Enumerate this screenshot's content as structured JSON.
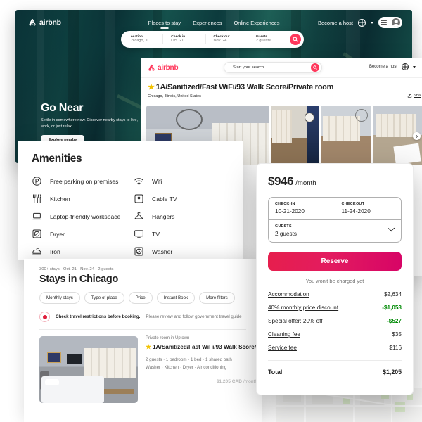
{
  "brand": {
    "name": "airbnb",
    "accent": "#FF385C",
    "reserve_gradient_from": "#E61E4D",
    "reserve_gradient_to": "#D70466",
    "discount_green": "#008a05",
    "star_yellow": "#f2c200"
  },
  "hero_page": {
    "logo_text": "airbnb",
    "nav_links": [
      "Places to stay",
      "Experiences",
      "Online Experiences"
    ],
    "become_host": "Become a host",
    "search": {
      "fields": [
        {
          "label": "Location",
          "value": "Chicago, IL"
        },
        {
          "label": "Check in",
          "value": "Oct. 21"
        },
        {
          "label": "Check out",
          "value": "Nov. 24"
        },
        {
          "label": "Guests",
          "value": "2 guests"
        }
      ],
      "search_icon": "search-icon"
    },
    "promo": {
      "heading": "Go Near",
      "body": "Settle in somewhere new. Discover nearby stays to live, work, or just relax.",
      "cta": "Explore nearby"
    }
  },
  "listing_page": {
    "logo_text": "airbnb",
    "search_placeholder": "Start your search",
    "become_host": "Become a host",
    "title": "1A/Sanitized/Fast WiFi/93 Walk Score/Private room",
    "location": "Chicago, Illinois, United States",
    "share_label": "Sha",
    "gallery_photos": [
      "bedroom-wide-photo",
      "dining-room-photo",
      "bedroom-window-photo",
      "living-room-photo"
    ]
  },
  "amenities_panel": {
    "heading": "Amenities",
    "items": [
      {
        "label": "Free parking on premises",
        "icon": "parking-icon"
      },
      {
        "label": "Wifi",
        "icon": "wifi-icon"
      },
      {
        "label": "Kitchen",
        "icon": "kitchen-utensils-icon"
      },
      {
        "label": "Cable TV",
        "icon": "cable-tv-icon"
      },
      {
        "label": "Laptop-friendly workspace",
        "icon": "laptop-icon"
      },
      {
        "label": "Hangers",
        "icon": "hanger-icon"
      },
      {
        "label": "Dryer",
        "icon": "dryer-icon"
      },
      {
        "label": "TV",
        "icon": "tv-icon"
      },
      {
        "label": "Iron",
        "icon": "iron-icon"
      },
      {
        "label": "Washer",
        "icon": "washer-icon"
      }
    ]
  },
  "booking_card": {
    "price_amount": "$946",
    "price_period": "/month",
    "checkin_label": "CHECK-IN",
    "checkin_value": "10-21-2020",
    "checkout_label": "CHECKOUT",
    "checkout_value": "11-24-2020",
    "guests_label": "GUESTS",
    "guests_value": "2 guests",
    "reserve_button": "Reserve",
    "no_charge_note": "You won't be charged yet",
    "fees": [
      {
        "label": "Accommodation",
        "value": "$2,634",
        "discount": false
      },
      {
        "label": "40% monthly price discount",
        "value": "-$1,053",
        "discount": true
      },
      {
        "label": "Special offer: 20% off",
        "value": "-$527",
        "discount": true
      },
      {
        "label": "Cleaning fee",
        "value": "$35",
        "discount": false
      },
      {
        "label": "Service fee",
        "value": "$116",
        "discount": false
      }
    ],
    "total_label": "Total",
    "total_value": "$1,205"
  },
  "results_page": {
    "meta": "300+ stays · Oct. 21 - Nov. 24 · 2 guests",
    "heading": "Stays in Chicago",
    "filters": [
      "Monthly stays",
      "Type of place",
      "Price",
      "Instant Book",
      "More filters"
    ],
    "notice_bold": "Check travel restrictions before booking.",
    "notice_text": "Please review and follow government travel guide",
    "card": {
      "kind": "Private room in Uptown",
      "title": "1A/Sanitized/Fast WiFi/93 Walk Score/",
      "facts_line1": "2 guests · 1 bedroom · 1 bed · 1 shared bath",
      "facts_line2": "Washer · Kitchen · Dryer · Air conditioning",
      "price": "$1,205 CAD",
      "price_period": " /month"
    }
  }
}
